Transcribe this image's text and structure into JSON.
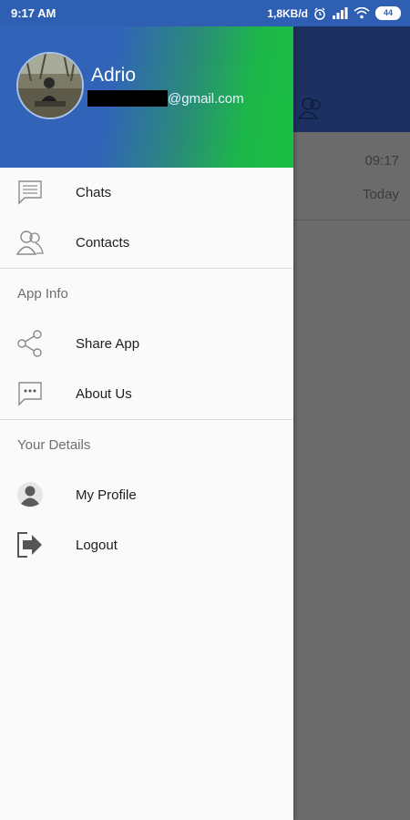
{
  "status_bar": {
    "time": "9:17 AM",
    "net_speed": "1,8KB/d",
    "battery": "44"
  },
  "drawer": {
    "user_name": "Adrio",
    "email_domain": "@gmail.com",
    "menu": [
      {
        "label": "Chats",
        "icon": "chat-icon"
      },
      {
        "label": "Contacts",
        "icon": "contacts-icon"
      }
    ],
    "app_info": {
      "title": "App Info",
      "items": [
        {
          "label": "Share App",
          "icon": "share-icon"
        },
        {
          "label": "About Us",
          "icon": "about-icon"
        }
      ]
    },
    "your_details": {
      "title": "Your Details",
      "items": [
        {
          "label": "My Profile",
          "icon": "profile-icon"
        },
        {
          "label": "Logout",
          "icon": "logout-icon"
        }
      ]
    }
  },
  "background": {
    "time": "09:17",
    "date": "Today"
  },
  "colors": {
    "header_blue": "#3164b8",
    "header_green": "#19c040",
    "status_bar": "#2f5fb2"
  }
}
